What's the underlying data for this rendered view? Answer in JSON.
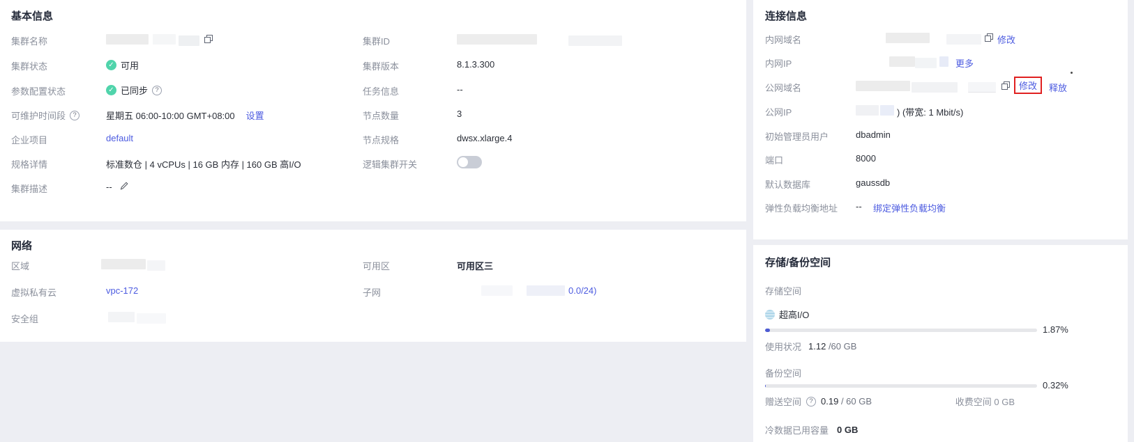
{
  "basic_info": {
    "title": "基本信息",
    "cluster_name_label": "集群名称",
    "cluster_status_label": "集群状态",
    "cluster_status_value": "可用",
    "param_status_label": "参数配置状态",
    "param_status_value": "已同步",
    "maintenance_label": "可维护时间段",
    "maintenance_value": "星期五 06:00-10:00 GMT+08:00",
    "maintenance_action": "设置",
    "enterprise_label": "企业项目",
    "enterprise_value": "default",
    "spec_label": "规格详情",
    "spec_value": "标准数仓 | 4 vCPUs | 16 GB 内存 | 160 GB 高I/O",
    "desc_label": "集群描述",
    "desc_value": "--",
    "cluster_id_label": "集群ID",
    "version_label": "集群版本",
    "version_value": "8.1.3.300",
    "task_label": "任务信息",
    "task_value": "--",
    "node_count_label": "节点数量",
    "node_count_value": "3",
    "node_spec_label": "节点规格",
    "node_spec_value": "dwsx.xlarge.4",
    "logical_switch_label": "逻辑集群开关"
  },
  "network": {
    "title": "网络",
    "region_label": "区域",
    "vpc_label": "虚拟私有云",
    "vpc_value": "vpc-172",
    "sg_label": "安全组",
    "az_label": "可用区",
    "az_value": "可用区三",
    "subnet_label": "子网",
    "subnet_visible_text": "0.0/24)"
  },
  "connection": {
    "title": "连接信息",
    "private_domain_label": "内网域名",
    "modify_action": "修改",
    "private_ip_label": "内网IP",
    "more_action": "更多",
    "public_domain_label": "公网域名",
    "public_modify_action": "修改",
    "release_action": "释放",
    "public_ip_label": "公网IP",
    "public_ip_suffix": ") (带宽: 1 Mbit/s)",
    "admin_label": "初始管理员用户",
    "admin_value": "dbadmin",
    "port_label": "端口",
    "port_value": "8000",
    "db_label": "默认数据库",
    "db_value": "gaussdb",
    "elb_label": "弹性负载均衡地址",
    "elb_value": "--",
    "elb_action": "绑定弹性负载均衡"
  },
  "storage": {
    "title": "存储/备份空间",
    "storage_space_label": "存储空间",
    "disk_type": "超高I/O",
    "storage_percent": "1.87%",
    "storage_bar_width": "1.87%",
    "usage_label": "使用状况",
    "usage_value": "1.12",
    "usage_total": " /60 GB",
    "backup_label": "备份空间",
    "backup_percent": "0.32%",
    "backup_bar_width": "0.32%",
    "free_label": "赠送空间",
    "free_value": "0.19",
    "free_total": " / 60 GB",
    "charged_label": "收费空间 0 GB",
    "cold_label": "冷数据已用容量",
    "cold_value": "0 GB"
  },
  "colors": {
    "link_blue": "#4c5be0",
    "status_green": "#50d4ab",
    "progress_blue": "#4d5bd3",
    "annotation_red": "#e02020",
    "page_background": "#edeef3"
  }
}
